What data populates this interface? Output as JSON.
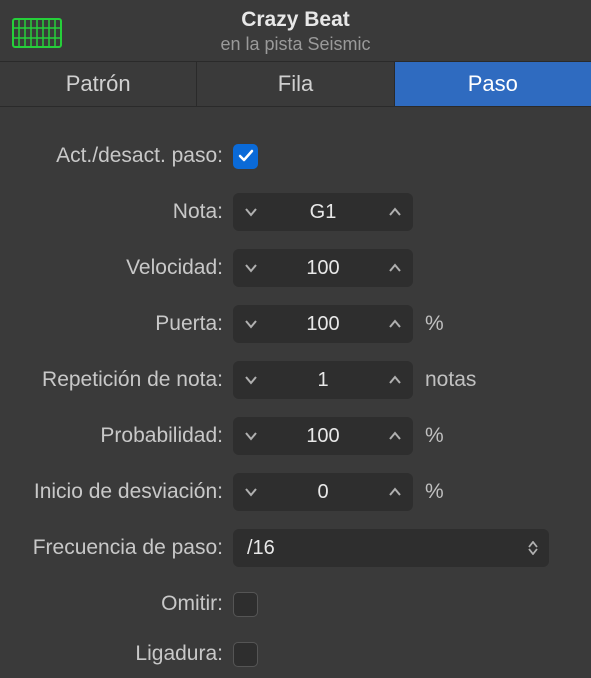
{
  "header": {
    "title": "Crazy Beat",
    "subtitle": "en la pista Seismic"
  },
  "tabs": {
    "pattern": "Patrón",
    "row": "Fila",
    "step": "Paso"
  },
  "fields": {
    "stepOnOff": {
      "label": "Act./desact. paso:"
    },
    "note": {
      "label": "Nota:",
      "value": "G1"
    },
    "velocity": {
      "label": "Velocidad:",
      "value": "100"
    },
    "gate": {
      "label": "Puerta:",
      "value": "100",
      "unit": "%"
    },
    "noteRepeat": {
      "label": "Repetición de nota:",
      "value": "1",
      "unit": "notas"
    },
    "probability": {
      "label": "Probabilidad:",
      "value": "100",
      "unit": "%"
    },
    "offsetStart": {
      "label": "Inicio de desviación:",
      "value": "0",
      "unit": "%"
    },
    "stepRate": {
      "label": "Frecuencia de paso:",
      "value": "/16"
    },
    "skip": {
      "label": "Omitir:"
    },
    "tie": {
      "label": "Ligadura:"
    }
  }
}
